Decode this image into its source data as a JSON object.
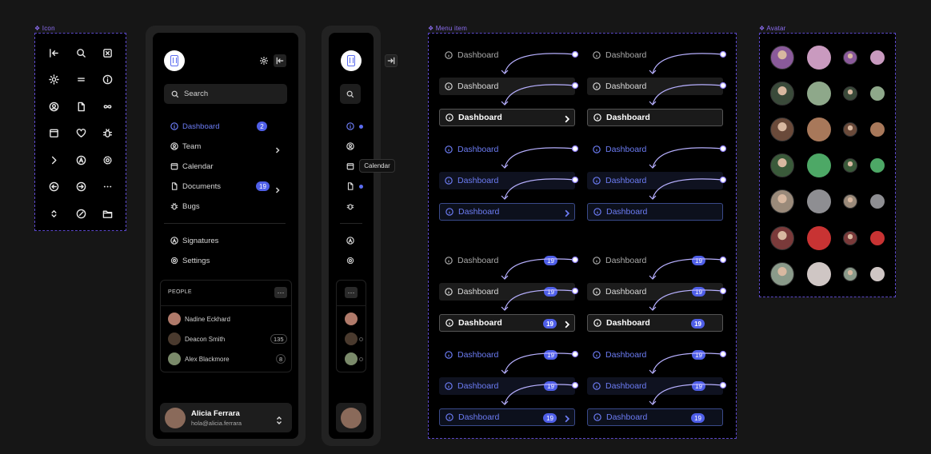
{
  "frames": {
    "icon": "❖ Icon",
    "menu_item": "❖ Menu item",
    "avatar": "❖ Avatar"
  },
  "icons": [
    [
      "arrow-left-to-line-icon",
      "search-icon",
      "square-x-icon"
    ],
    [
      "sun-icon",
      "equals-icon",
      "info-icon"
    ],
    [
      "user-circle-icon",
      "file-icon",
      "infinity-icon"
    ],
    [
      "calendar-icon",
      "heart-icon",
      "bug-icon"
    ],
    [
      "chevron-right-icon",
      "signature-icon",
      "gear-icon"
    ],
    [
      "arrow-left-circle-icon",
      "arrow-right-circle-icon",
      "more-horizontal-icon"
    ],
    [
      "chevron-up-down-icon",
      "compass-icon",
      "folder-icon"
    ]
  ],
  "sidebar": {
    "search_label": "Search",
    "nav": [
      {
        "label": "Dashboard",
        "badge": "2",
        "icon": "info-icon"
      },
      {
        "label": "Team",
        "icon": "user-circle-icon"
      },
      {
        "label": "Calendar",
        "icon": "calendar-icon"
      },
      {
        "label": "Documents",
        "badge": "19",
        "icon": "file-icon"
      },
      {
        "label": "Bugs",
        "icon": "bug-icon"
      }
    ],
    "secondary": [
      {
        "label": "Signatures",
        "icon": "signature-icon"
      },
      {
        "label": "Settings",
        "icon": "gear-icon"
      }
    ],
    "people_title": "PEOPLE",
    "people_menu": "···",
    "people": [
      {
        "name": "Nadine Eckhard",
        "color": "#b07a6a"
      },
      {
        "name": "Deacon Smith",
        "count": "135",
        "color": "#5a4a3a"
      },
      {
        "name": "Alex Blackmore",
        "count": "8",
        "color": "#7a8a6a"
      }
    ],
    "user": {
      "name": "Alicia Ferrara",
      "email": "hola@alicia.ferrara"
    }
  },
  "collapsed": {
    "tooltip": "Calendar",
    "people_menu": "···"
  },
  "menu_item": {
    "label": "Dashboard",
    "badge": "19"
  },
  "avatars": {
    "colors": [
      "#c99abf",
      "#8ea88a",
      "#a8785a",
      "#4da866",
      "#8e8e92",
      "#c83333",
      "#cfc6c4"
    ],
    "photo_colors": [
      "#8a5a9a",
      "#3a4a3a",
      "#6a4a3a",
      "#3a5a3a",
      "#9a8a7a",
      "#7a3a3a",
      "#8a9a8a"
    ]
  }
}
